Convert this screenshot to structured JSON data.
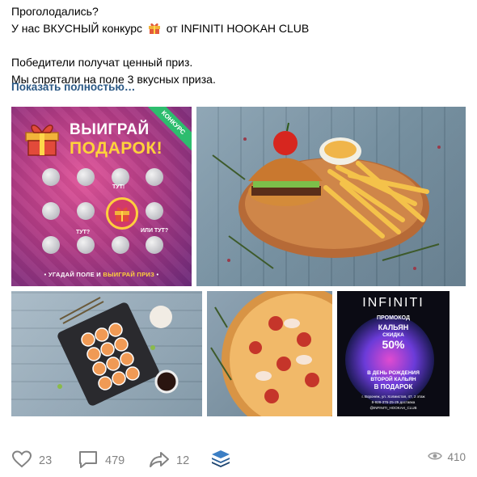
{
  "post": {
    "line1": "Проголодались?",
    "line2_start": "У нас ВКУСНЫЙ конкурс",
    "line2_end": "от INFINITI HOOKAH CLUB",
    "line3": "Победители получат ценный приз.",
    "line4": "Мы спрятали на поле 3 вкусных приза.",
    "show_more": "Показать полностью…"
  },
  "contest_image": {
    "title1": "ВЫИГРАЙ",
    "title2": "ПОДАРОК!",
    "ribbon": "КОНКУРС",
    "tut_center": "ТУТ!",
    "tut_left": "ТУТ?",
    "tut_right": "ИЛИ ТУТ?",
    "bottom_a": "• УГАДАЙ ПОЛЕ И ",
    "bottom_b": "ВЫИГРАЙ ПРИЗ",
    "bottom_c": " •"
  },
  "infiniti_image": {
    "brand": "INFINITI",
    "line1": "ПРОМОКОД",
    "line2": "КАЛЬЯН",
    "line3": "СКИДКА",
    "line4": "50%",
    "line5": "В ДЕНЬ РОЖДЕНИЯ",
    "line6": "ВТОРОЙ КАЛЬЯН",
    "line7": "В ПОДАРОК",
    "addr": "г. Воронеж, ул. Холмистая, 47, 2 этаж",
    "phone": "8-928-376-25-25 доставка",
    "handle": "@INFINITI_HOOKAH_CLUB"
  },
  "stats": {
    "likes": "23",
    "comments": "479",
    "shares": "12",
    "views": "410"
  },
  "colors": {
    "link": "#2a5885",
    "muted": "#828282"
  }
}
